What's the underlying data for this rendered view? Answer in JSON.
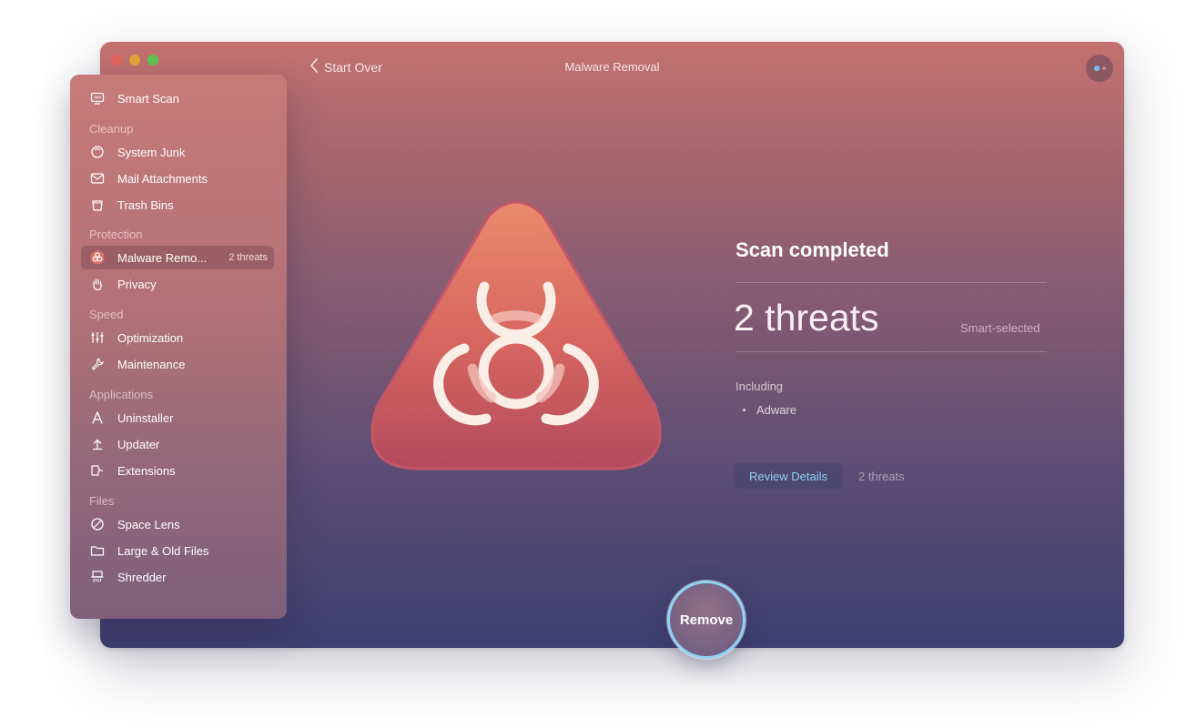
{
  "window": {
    "title": "Malware Removal",
    "back_label": "Start Over"
  },
  "sidebar": {
    "top_item": {
      "label": "Smart Scan",
      "icon": "monitor-icon"
    },
    "sections": [
      {
        "title": "Cleanup",
        "items": [
          {
            "label": "System Junk",
            "icon": "recycle-icon"
          },
          {
            "label": "Mail Attachments",
            "icon": "envelope-icon"
          },
          {
            "label": "Trash Bins",
            "icon": "trash-icon"
          }
        ]
      },
      {
        "title": "Protection",
        "items": [
          {
            "label": "Malware Remo...",
            "icon": "biohazard-icon",
            "badge": "2 threats",
            "active": true
          },
          {
            "label": "Privacy",
            "icon": "hand-icon"
          }
        ]
      },
      {
        "title": "Speed",
        "items": [
          {
            "label": "Optimization",
            "icon": "sliders-icon"
          },
          {
            "label": "Maintenance",
            "icon": "wrench-icon"
          }
        ]
      },
      {
        "title": "Applications",
        "items": [
          {
            "label": "Uninstaller",
            "icon": "uninstaller-icon"
          },
          {
            "label": "Updater",
            "icon": "update-arrow-icon"
          },
          {
            "label": "Extensions",
            "icon": "extension-icon"
          }
        ]
      },
      {
        "title": "Files",
        "items": [
          {
            "label": "Space Lens",
            "icon": "lens-icon"
          },
          {
            "label": "Large & Old Files",
            "icon": "folder-icon"
          },
          {
            "label": "Shredder",
            "icon": "shredder-icon"
          }
        ]
      }
    ]
  },
  "main": {
    "status_title": "Scan completed",
    "threat_count": "2 threats",
    "smart_selected": "Smart-selected",
    "including_label": "Including",
    "threat_types": [
      "Adware"
    ],
    "review_button": "Review Details",
    "review_count": "2 threats",
    "remove_button": "Remove"
  },
  "colors": {
    "accent_blue": "#8fd3f4",
    "hazard_top": "#e9876c",
    "hazard_bottom": "#b24a5e"
  }
}
